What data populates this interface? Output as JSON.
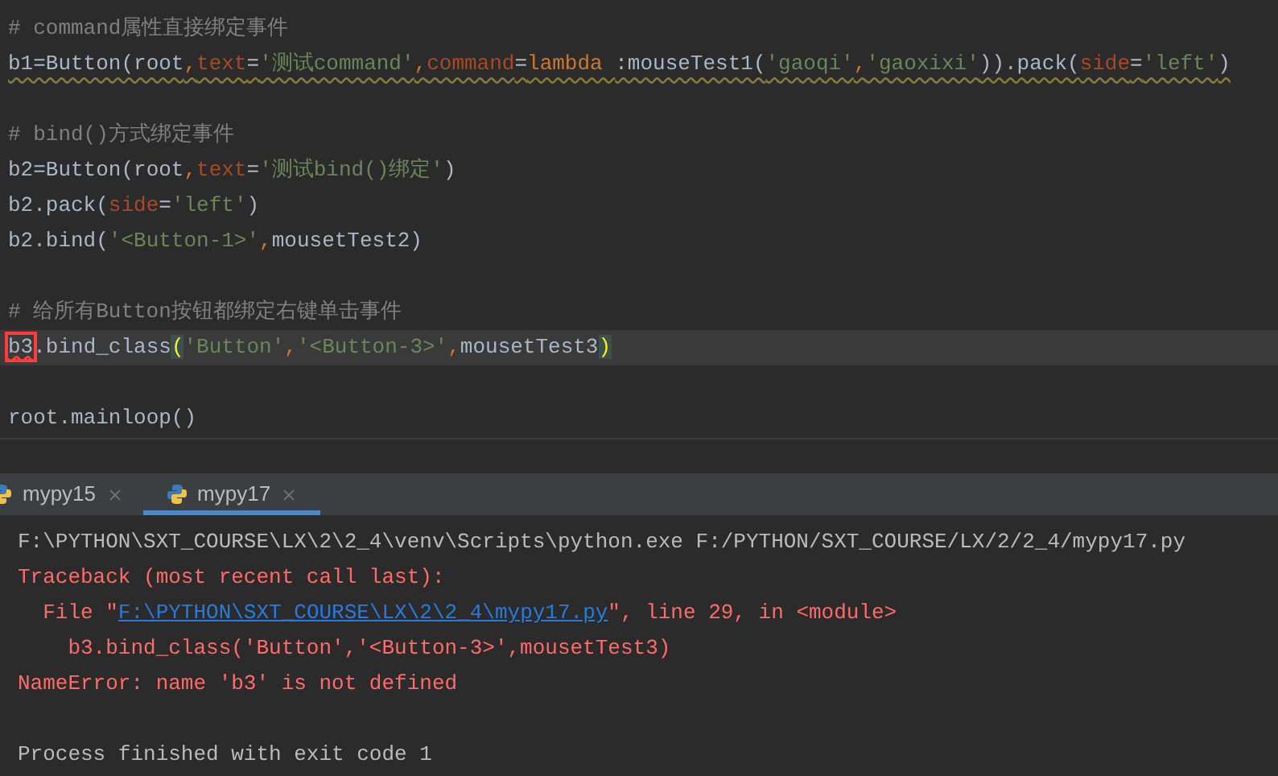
{
  "editor": {
    "lines": [
      {
        "current": false,
        "tokens": [
          {
            "kind": "comment",
            "text": "# command属性直接绑定事件"
          }
        ]
      },
      {
        "current": false,
        "warning": true,
        "tokens": [
          {
            "kind": "plain",
            "text": "b1=Button(root"
          },
          {
            "kind": "keyword",
            "text": ","
          },
          {
            "kind": "param",
            "text": "text"
          },
          {
            "kind": "plain",
            "text": "="
          },
          {
            "kind": "string",
            "text": "'测试command'"
          },
          {
            "kind": "keyword",
            "text": ","
          },
          {
            "kind": "param",
            "text": "command"
          },
          {
            "kind": "plain",
            "text": "="
          },
          {
            "kind": "keyword",
            "text": "lambda "
          },
          {
            "kind": "plain",
            "text": ":mouseTest1("
          },
          {
            "kind": "string",
            "text": "'gaoqi'"
          },
          {
            "kind": "keyword",
            "text": ","
          },
          {
            "kind": "string",
            "text": "'gaoxixi'"
          },
          {
            "kind": "plain",
            "text": ")).pack("
          },
          {
            "kind": "param",
            "text": "side"
          },
          {
            "kind": "plain",
            "text": "="
          },
          {
            "kind": "string",
            "text": "'left'"
          },
          {
            "kind": "plain",
            "text": ")"
          }
        ]
      },
      {
        "current": false
      },
      {
        "current": false,
        "tokens": [
          {
            "kind": "comment",
            "text": "# bind()方式绑定事件"
          }
        ]
      },
      {
        "current": false,
        "tokens": [
          {
            "kind": "plain",
            "text": "b2=Button(root"
          },
          {
            "kind": "keyword",
            "text": ","
          },
          {
            "kind": "param",
            "text": "text"
          },
          {
            "kind": "plain",
            "text": "="
          },
          {
            "kind": "string",
            "text": "'测试bind()绑定'"
          },
          {
            "kind": "plain",
            "text": ")"
          }
        ]
      },
      {
        "current": false,
        "tokens": [
          {
            "kind": "plain",
            "text": "b2.pack("
          },
          {
            "kind": "param",
            "text": "side"
          },
          {
            "kind": "plain",
            "text": "="
          },
          {
            "kind": "string",
            "text": "'left'"
          },
          {
            "kind": "plain",
            "text": ")"
          }
        ]
      },
      {
        "current": false,
        "tokens": [
          {
            "kind": "plain",
            "text": "b2.bind("
          },
          {
            "kind": "string",
            "text": "'<Button-1>'"
          },
          {
            "kind": "keyword",
            "text": ","
          },
          {
            "kind": "plain",
            "text": "mousetTest2)"
          }
        ]
      },
      {
        "current": false
      },
      {
        "current": false,
        "tokens": [
          {
            "kind": "comment",
            "text": "# 给所有Button按钮都绑定右键单击事件"
          }
        ]
      },
      {
        "current": true,
        "tokens": [
          {
            "kind": "error",
            "text": "b3"
          },
          {
            "kind": "plain",
            "text": ".bind_class"
          },
          {
            "kind": "brace",
            "text": "("
          },
          {
            "kind": "string",
            "text": "'Button'"
          },
          {
            "kind": "keyword",
            "text": ","
          },
          {
            "kind": "string",
            "text": "'<Button-3>'"
          },
          {
            "kind": "keyword",
            "text": ","
          },
          {
            "kind": "plain",
            "text": "mousetTest3"
          },
          {
            "kind": "brace",
            "text": ")"
          }
        ]
      },
      {
        "current": false
      },
      {
        "current": false,
        "tokens": [
          {
            "kind": "plain",
            "text": "root.mainloop()"
          }
        ]
      }
    ]
  },
  "run_tabs": [
    {
      "label": "mypy15",
      "selected": false
    },
    {
      "label": "mypy17",
      "selected": true
    }
  ],
  "console": {
    "lines": [
      {
        "kind": "normal",
        "parts": [
          {
            "text": "F:\\PYTHON\\SXT_COURSE\\LX\\2\\2_4\\venv\\Scripts\\python.exe F:/PYTHON/SXT_COURSE/LX/2/2_4/mypy17.py"
          }
        ]
      },
      {
        "kind": "error",
        "parts": [
          {
            "text": "Traceback (most recent call last):"
          }
        ]
      },
      {
        "kind": "error",
        "parts": [
          {
            "text": "  File \""
          },
          {
            "text": "F:\\PYTHON\\SXT_COURSE\\LX\\2\\2_4\\mypy17.py",
            "link": true
          },
          {
            "text": "\", line 29, in <module>"
          }
        ]
      },
      {
        "kind": "error",
        "parts": [
          {
            "text": "    b3.bind_class('Button','<Button-3>',mousetTest3)"
          }
        ]
      },
      {
        "kind": "error",
        "parts": [
          {
            "text": "NameError: name 'b3' is not defined"
          }
        ]
      },
      {
        "kind": "blank"
      },
      {
        "kind": "normal",
        "parts": [
          {
            "text": "Process finished with exit code 1"
          }
        ]
      }
    ]
  }
}
